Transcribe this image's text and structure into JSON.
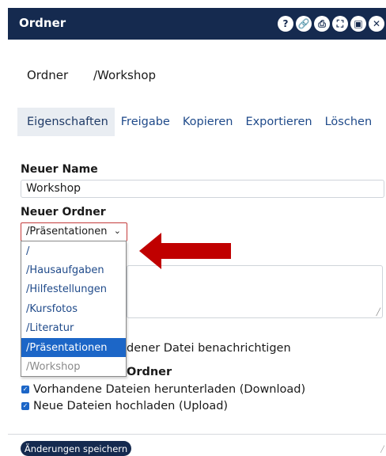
{
  "window": {
    "title": "Ordner",
    "toolbar_icons": [
      "help-icon",
      "link-icon",
      "print-icon",
      "fullscreen-icon",
      "window-icon",
      "close-icon"
    ]
  },
  "folder_row": {
    "label": "Ordner",
    "value": "/Workshop"
  },
  "tabs": [
    {
      "label": "Eigenschaften",
      "active": true
    },
    {
      "label": "Freigabe"
    },
    {
      "label": "Kopieren"
    },
    {
      "label": "Exportieren"
    },
    {
      "label": "Löschen"
    }
  ],
  "form": {
    "new_name_label": "Neuer Name",
    "new_name_value": "Workshop",
    "new_folder_label": "Neuer Ordner",
    "new_folder_selected": "/Präsentationen",
    "dropdown_options": [
      {
        "label": "/"
      },
      {
        "label": "/Hausaufgaben"
      },
      {
        "label": "/Hilfestellungen"
      },
      {
        "label": "/Kursfotos"
      },
      {
        "label": "/Literatur"
      },
      {
        "label": "/Präsentationen",
        "selected": true
      },
      {
        "label": "/Workshop",
        "disabled": true
      }
    ],
    "notify_text": "dener Datei benachrichtigen",
    "permissions_heading": "Ordner",
    "checkbox_download": "Vorhandene Dateien herunterladen (Download)",
    "checkbox_upload": "Neue Dateien hochladen (Upload)"
  },
  "save_button": "Änderungen speichern",
  "colors": {
    "header_bg": "#152a4f",
    "link_blue": "#1f4a8a",
    "selection_blue": "#1c66c7",
    "arrow_red": "#c00000"
  }
}
